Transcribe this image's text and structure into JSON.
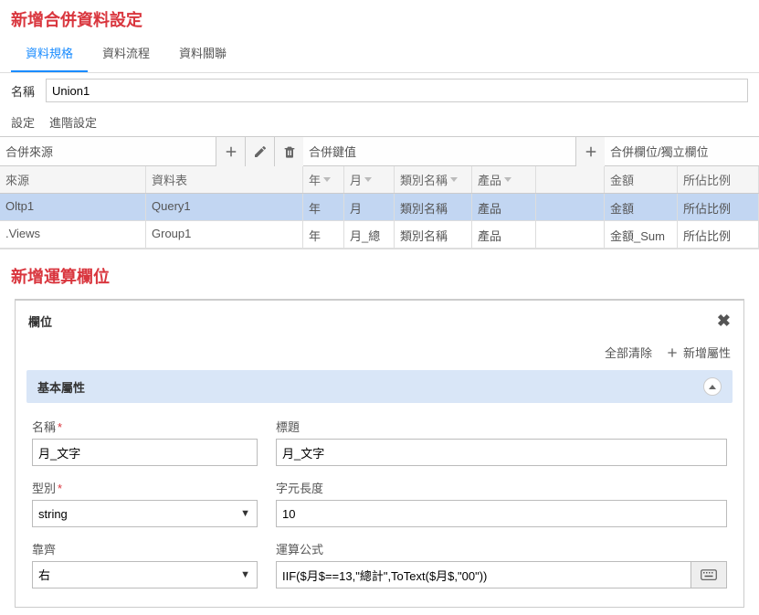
{
  "mainTitle": "新增合併資料設定",
  "tabs": [
    {
      "label": "資料規格",
      "active": true
    },
    {
      "label": "資料流程",
      "active": false
    },
    {
      "label": "資料關聯",
      "active": false
    }
  ],
  "nameField": {
    "label": "名稱",
    "value": "Union1"
  },
  "subtabs": [
    {
      "label": "設定",
      "active": true
    },
    {
      "label": "進階設定",
      "active": false
    }
  ],
  "mergeSource": {
    "title": "合併來源",
    "columns": [
      "來源",
      "資料表"
    ],
    "rows": [
      {
        "source": "Oltp1",
        "table": "Query1",
        "selected": true
      },
      {
        "source": ".Views",
        "table": "Group1",
        "selected": false
      }
    ]
  },
  "mergeKey": {
    "title": "合併鍵值",
    "columns": [
      "年",
      "月",
      "類別名稱",
      "產品"
    ],
    "rows": [
      {
        "cells": [
          "年",
          "月",
          "類別名稱",
          "產品"
        ],
        "selected": true
      },
      {
        "cells": [
          "年",
          "月_總",
          "類別名稱",
          "產品"
        ],
        "selected": false
      }
    ]
  },
  "mergeCols": {
    "title": "合併欄位/獨立欄位",
    "columns": [
      "金額",
      "所佔比例"
    ],
    "rows": [
      {
        "cells": [
          "金額",
          "所佔比例"
        ],
        "selected": true
      },
      {
        "cells": [
          "金額_Sum",
          "所佔比例"
        ],
        "selected": false
      }
    ]
  },
  "computedTitle": "新增運算欄位",
  "panelHeaderTitle": "欄位",
  "toolbar": {
    "clearAll": "全部清除",
    "addProp": "新增屬性"
  },
  "accordion": {
    "title": "基本屬性"
  },
  "form": {
    "name": {
      "label": "名稱",
      "value": "月_文字",
      "required": true
    },
    "title": {
      "label": "標題",
      "value": "月_文字",
      "required": false
    },
    "type": {
      "label": "型別",
      "value": "string",
      "required": true
    },
    "length": {
      "label": "字元長度",
      "value": "10"
    },
    "align": {
      "label": "靠齊",
      "value": "右"
    },
    "formula": {
      "label": "運算公式",
      "value": "IIF($月$==13,\"總計\",ToText($月$,\"00\"))"
    }
  }
}
